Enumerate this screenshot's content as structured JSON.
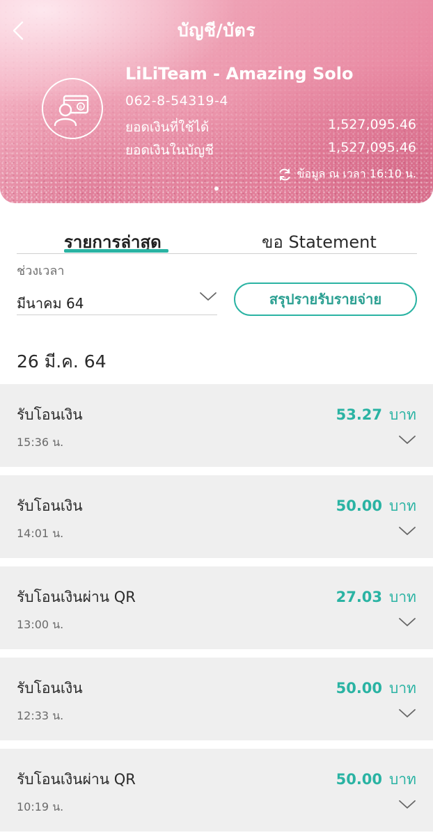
{
  "header": {
    "title": "บัญชี/บัตร",
    "account_name": "LiLiTeam - Amazing Solo",
    "account_number": "062-8-54319-4",
    "available_label": "ยอดเงินที่ใช้ได้",
    "available_value": "1,527,095.46",
    "balance_label": "ยอดเงินในบัญชี",
    "balance_value": "1,527,095.46",
    "updated_text": "ข้อมูล ณ เวลา 16:10 น."
  },
  "tabs": [
    {
      "label": "รายการล่าสุด",
      "active": true
    },
    {
      "label": "ขอ Statement",
      "active": false
    }
  ],
  "period": {
    "label": "ช่วงเวลา",
    "selected": "มีนาคม 64"
  },
  "summary_button": "สรุปรายรับรายจ่าย",
  "date_heading": "26 มี.ค. 64",
  "transactions": [
    {
      "title": "รับโอนเงิน",
      "time": "15:36 น.",
      "amount": "53.27",
      "unit": "บาท"
    },
    {
      "title": "รับโอนเงิน",
      "time": "14:01 น.",
      "amount": "50.00",
      "unit": "บาท"
    },
    {
      "title": "รับโอนเงินผ่าน QR",
      "time": "13:00 น.",
      "amount": "27.03",
      "unit": "บาท"
    },
    {
      "title": "รับโอนเงิน",
      "time": "12:33 น.",
      "amount": "50.00",
      "unit": "บาท"
    },
    {
      "title": "รับโอนเงินผ่าน QR",
      "time": "10:19 น.",
      "amount": "50.00",
      "unit": "บาท"
    }
  ],
  "colors": {
    "accent": "#2ab3a3",
    "header_pink": "#ee9fb3"
  }
}
